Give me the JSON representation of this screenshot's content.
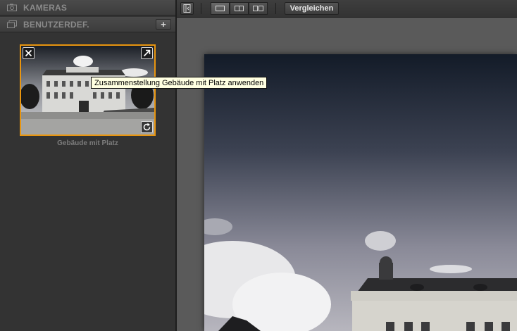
{
  "left_panel": {
    "sections": [
      {
        "label": "KAMERAS",
        "icon": "camera-icon"
      },
      {
        "label": "BENUTZERDEF.",
        "icon": "user-presets-icon",
        "add_label": "+"
      }
    ],
    "thumbnail": {
      "label": "Gebäude mit Platz",
      "tooltip": "Zusammenstellung Gebäude mit Platz anwenden",
      "accent": "#e8950f"
    }
  },
  "toolbar": {
    "compare_label": "Vergleichen"
  },
  "colors": {
    "panel_bg": "#333333",
    "canvas_bg": "#5a5a5a",
    "tooltip_bg": "#ffffe1"
  }
}
